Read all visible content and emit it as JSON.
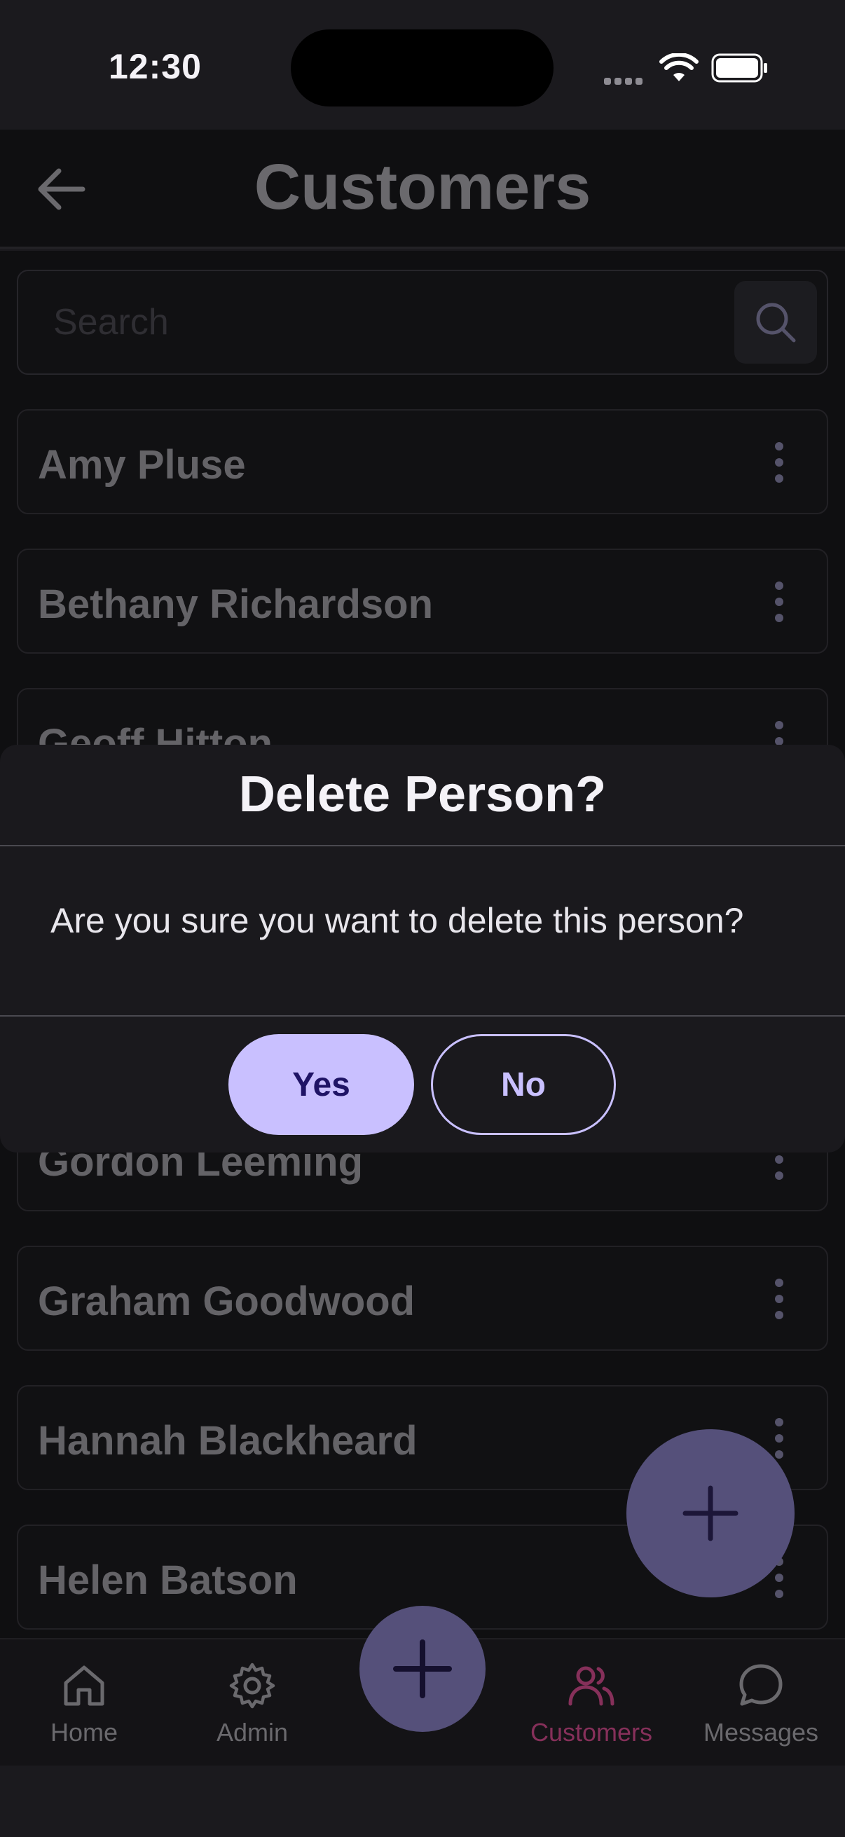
{
  "status_bar": {
    "time": "12:30"
  },
  "header": {
    "title": "Customers"
  },
  "search": {
    "placeholder": "Search",
    "value": ""
  },
  "people": [
    {
      "name": "Amy Pluse"
    },
    {
      "name": "Bethany Richardson"
    },
    {
      "name": "Geoff Hitton"
    },
    {
      "name": ""
    },
    {
      "name": ""
    },
    {
      "name": "Gordon Leeming"
    },
    {
      "name": "Graham Goodwood"
    },
    {
      "name": "Hannah Blackheard"
    },
    {
      "name": "Helen Batson"
    }
  ],
  "dialog": {
    "title": "Delete Person?",
    "message": "Are you sure you want to delete this person?",
    "yes_label": "Yes",
    "no_label": "No"
  },
  "nav": {
    "items": [
      {
        "label": "Home",
        "icon": "home-icon"
      },
      {
        "label": "Admin",
        "icon": "gear-icon"
      },
      {
        "label": "Customers",
        "icon": "users-icon",
        "active": true
      },
      {
        "label": "Messages",
        "icon": "chat-icon"
      }
    ]
  },
  "colors": {
    "accent": "#c9c0ff",
    "active_nav": "#86305a",
    "fab": "#55507a"
  }
}
